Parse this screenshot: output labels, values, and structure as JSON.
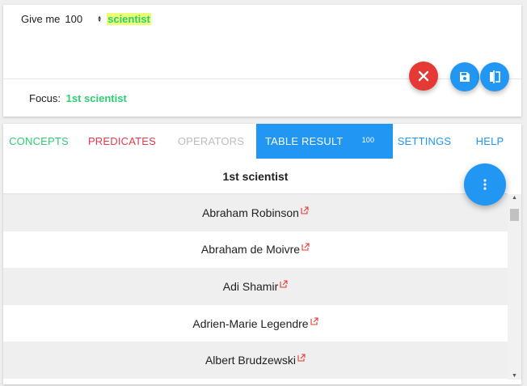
{
  "query": {
    "give_me_label": "Give me",
    "quantity": "100",
    "concept": "scientist"
  },
  "focus": {
    "label": "Focus:",
    "value": "1st scientist"
  },
  "tabs": {
    "concepts": "CONCEPTS",
    "predicates": "PREDICATES",
    "operators": "OPERATORS",
    "table_result": "TABLE RESULT",
    "table_result_count": "100",
    "settings": "SETTINGS",
    "help": "HELP"
  },
  "table": {
    "header": "1st scientist",
    "rows": [
      "Abraham Robinson",
      "Abraham de Moivre",
      "Adi Shamir",
      "Adrien-Marie Legendre",
      "Albert Brudzewski"
    ]
  },
  "colors": {
    "accent_blue": "#2196f3",
    "danger_red": "#e53935",
    "concept_green": "#2ecc71",
    "predicate_red": "#e53950",
    "highlight_yellow": "#eaff73"
  },
  "icons": {
    "clear": "close-icon",
    "save": "save-icon",
    "compare": "compare-icon",
    "menu": "more-vert-icon",
    "external": "external-link-icon"
  }
}
